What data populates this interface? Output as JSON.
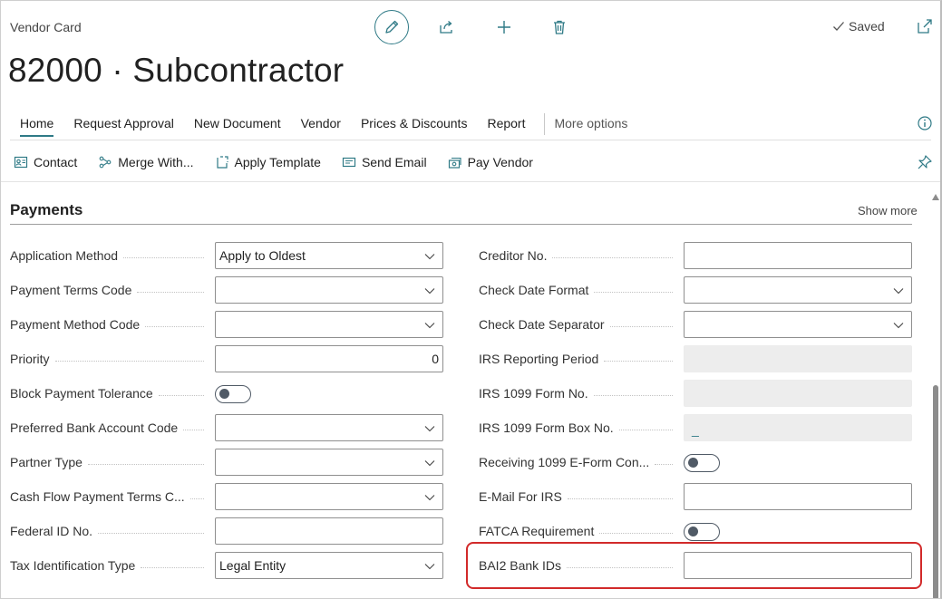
{
  "header": {
    "caption": "Vendor Card",
    "title": "82000 · Subcontractor",
    "saved_label": "Saved"
  },
  "tabs": [
    {
      "label": "Home",
      "active": true
    },
    {
      "label": "Request Approval"
    },
    {
      "label": "New Document"
    },
    {
      "label": "Vendor"
    },
    {
      "label": "Prices & Discounts"
    },
    {
      "label": "Report"
    }
  ],
  "more_options_label": "More options",
  "actions": [
    {
      "label": "Contact",
      "icon": "contact-card-icon"
    },
    {
      "label": "Merge With...",
      "icon": "merge-icon"
    },
    {
      "label": "Apply Template",
      "icon": "apply-template-icon"
    },
    {
      "label": "Send Email",
      "icon": "email-icon"
    },
    {
      "label": "Pay Vendor",
      "icon": "pay-vendor-icon"
    }
  ],
  "section": {
    "title": "Payments",
    "show_more": "Show more"
  },
  "left_fields": {
    "application_method": {
      "label": "Application Method",
      "value": "Apply to Oldest"
    },
    "payment_terms_code": {
      "label": "Payment Terms Code",
      "value": ""
    },
    "payment_method_code": {
      "label": "Payment Method Code",
      "value": ""
    },
    "priority": {
      "label": "Priority",
      "value": "0"
    },
    "block_payment_tolerance": {
      "label": "Block Payment Tolerance",
      "value": "off"
    },
    "preferred_bank_account_code": {
      "label": "Preferred Bank Account Code",
      "value": ""
    },
    "partner_type": {
      "label": "Partner Type",
      "value": ""
    },
    "cash_flow_payment_terms": {
      "label": "Cash Flow Payment Terms C...",
      "value": ""
    },
    "federal_id_no": {
      "label": "Federal ID No.",
      "value": ""
    },
    "tax_identification_type": {
      "label": "Tax Identification Type",
      "value": "Legal Entity"
    }
  },
  "right_fields": {
    "creditor_no": {
      "label": "Creditor No.",
      "value": ""
    },
    "check_date_format": {
      "label": "Check Date Format",
      "value": ""
    },
    "check_date_separator": {
      "label": "Check Date Separator",
      "value": ""
    },
    "irs_reporting_period": {
      "label": "IRS Reporting Period",
      "value": ""
    },
    "irs_1099_form_no": {
      "label": "IRS 1099 Form No.",
      "value": ""
    },
    "irs_1099_form_box_no": {
      "label": "IRS 1099 Form Box No.",
      "value": "_"
    },
    "receiving_1099_eform": {
      "label": "Receiving 1099 E-Form Con...",
      "value": "off"
    },
    "email_for_irs": {
      "label": "E-Mail For IRS",
      "value": ""
    },
    "fatca_requirement": {
      "label": "FATCA Requirement",
      "value": "off"
    },
    "bai2_bank_ids": {
      "label": "BAI2 Bank IDs",
      "value": ""
    }
  },
  "colors": {
    "accent": "#2f7a86",
    "highlight": "#d22a2a",
    "toggle": "#505a66"
  }
}
